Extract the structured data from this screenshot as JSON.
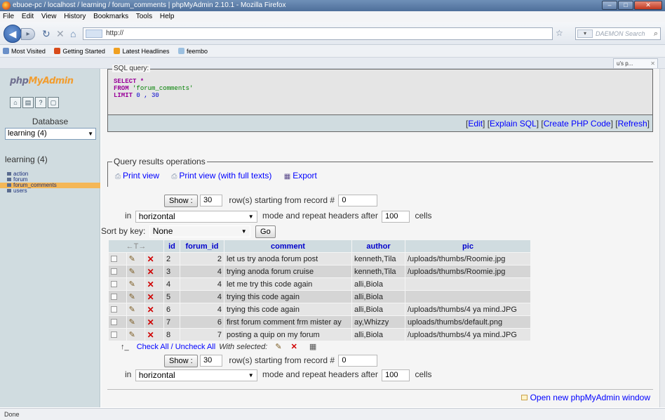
{
  "window": {
    "title": "ebuoe-pc / localhost / learning / forum_comments | phpMyAdmin 2.10.1 - Mozilla Firefox"
  },
  "menu": [
    "File",
    "Edit",
    "View",
    "History",
    "Bookmarks",
    "Tools",
    "Help"
  ],
  "nav": {
    "url": "http://",
    "search_placeholder": "DAEMON Search"
  },
  "bookmarks": [
    {
      "label": "Most Visited",
      "color": "#6a8fc8"
    },
    {
      "label": "Getting Started",
      "color": "#d84a1a"
    },
    {
      "label": "Latest Headlines",
      "color": "#f0a020"
    },
    {
      "label": "feembo",
      "color": "#9cc0e0"
    }
  ],
  "tab": {
    "label": "u's p..."
  },
  "left": {
    "logo_part1": "php",
    "logo_part2": "MyAdmin",
    "database_label": "Database",
    "database_selected": "learning (4)",
    "db_title": "learning (4)",
    "tables": [
      "action",
      "forum",
      "forum_comments",
      "users"
    ],
    "active_table": "forum_comments"
  },
  "sql": {
    "legend": "SQL query:",
    "line1": "SELECT *",
    "line2_kw": "FROM",
    "line2_val": "'forum_comments'",
    "line3_kw": "LIMIT",
    "line3_val": "0 , 30",
    "links": [
      "Edit",
      "Explain SQL",
      "Create PHP Code",
      "Refresh"
    ]
  },
  "query_results": {
    "legend": "Query results operations",
    "print_view": "Print view",
    "print_view_full": "Print view (with full texts)",
    "export": "Export"
  },
  "nav_top": {
    "show_label": "Show :",
    "rows": "30",
    "rows_text": "row(s) starting from record #",
    "start": "0",
    "in_label": "in",
    "mode": "horizontal",
    "mode_text": "mode and repeat headers after",
    "repeat": "100",
    "cells": "cells"
  },
  "sort": {
    "label": "Sort by key:",
    "value": "None",
    "go": "Go"
  },
  "table": {
    "headers": [
      "id",
      "forum_id",
      "comment",
      "author",
      "pic"
    ],
    "rows": [
      {
        "id": "2",
        "forum_id": "2",
        "comment": "let us try anoda forum post",
        "author": "kenneth,Tila",
        "pic": "/uploads/thumbs/Roomie.jpg"
      },
      {
        "id": "3",
        "forum_id": "4",
        "comment": "trying anoda forum cruise",
        "author": "kenneth,Tila",
        "pic": "/uploads/thumbs/Roomie.jpg"
      },
      {
        "id": "4",
        "forum_id": "4",
        "comment": "let me try this code again",
        "author": "alli,Biola",
        "pic": ""
      },
      {
        "id": "5",
        "forum_id": "4",
        "comment": "trying this code again",
        "author": "alli,Biola",
        "pic": ""
      },
      {
        "id": "6",
        "forum_id": "4",
        "comment": "trying this code  again",
        "author": "alli,Biola",
        "pic": "/uploads/thumbs/4 ya mind.JPG"
      },
      {
        "id": "7",
        "forum_id": "6",
        "comment": "first forum comment frm mister ay",
        "author": "ay,Whizzy",
        "pic": "uploads/thumbs/default.png"
      },
      {
        "id": "8",
        "forum_id": "7",
        "comment": "posting a quip on my forum",
        "author": "alli,Biola",
        "pic": "/uploads/thumbs/4 ya mind.JPG"
      }
    ]
  },
  "check_all": {
    "label": "Check All / Uncheck All",
    "with_selected": "With selected:"
  },
  "nav_bottom": {
    "show_label": "Show :",
    "rows": "30",
    "rows_text": "row(s) starting from record #",
    "start": "0",
    "in_label": "in",
    "mode": "horizontal",
    "mode_text": "mode and repeat headers after",
    "repeat": "100",
    "cells": "cells"
  },
  "new_window": "Open new phpMyAdmin window",
  "status": "Done"
}
